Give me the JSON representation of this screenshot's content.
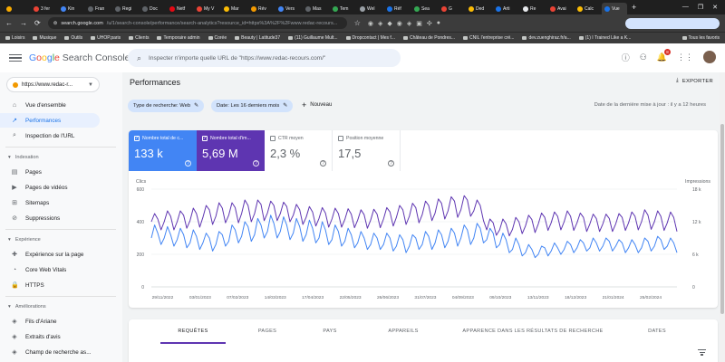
{
  "browser": {
    "tabs": [
      {
        "label": "",
        "color": "#f9ab00"
      },
      {
        "label": "3 fer",
        "color": "#ea4335"
      },
      {
        "label": "Kin",
        "color": "#4285f4"
      },
      {
        "label": "Fran",
        "color": "#5f6368"
      },
      {
        "label": "Regi",
        "color": "#5f6368"
      },
      {
        "label": "Doc",
        "color": "#5f6368"
      },
      {
        "label": "Netf",
        "color": "#e50914"
      },
      {
        "label": "My V",
        "color": "#ea4335"
      },
      {
        "label": "Mar",
        "color": "#fbbc05"
      },
      {
        "label": "Rév",
        "color": "#f29900"
      },
      {
        "label": "Vers",
        "color": "#4285f4"
      },
      {
        "label": "Mas",
        "color": "#5f6368"
      },
      {
        "label": "Tem",
        "color": "#34a853"
      },
      {
        "label": "Wel",
        "color": "#9aa0a6"
      },
      {
        "label": "Réf",
        "color": "#1a73e8"
      },
      {
        "label": "Sea",
        "color": "#34a853"
      },
      {
        "label": "G",
        "color": "#ea4335"
      },
      {
        "label": "Ded",
        "color": "#fbbc05"
      },
      {
        "label": "Arti",
        "color": "#1a73e8"
      },
      {
        "label": "Re",
        "color": "#e8eaed"
      },
      {
        "label": "Avai",
        "color": "#ea4335"
      },
      {
        "label": "Calc",
        "color": "#fbbc05"
      },
      {
        "label": "Vue",
        "color": "#1a73e8"
      }
    ],
    "active_tab": 22,
    "new_tab": "+",
    "window_controls": [
      "—",
      "❐",
      "✕"
    ],
    "url_host": "search.google.com",
    "url_path": "/u/1/search-console/performance/search-analytics?resource_id=https%3A%2F%2Fwww.redac-recours...",
    "bookmarks": [
      "Loisirs",
      "Musique",
      "Outils",
      "UHOP.paris",
      "Clients",
      "Temporaire admin",
      "Corée",
      "Beauty | Latitude37",
      "(11) Guillaume Mult...",
      "Dropcontact | Mes f...",
      "Château de Pondres...",
      "CNIL l'entreprise cré...",
      "dev.zuenghiraz.fr/a...",
      "(1) I Trained Like a K..."
    ],
    "bookmarks_end": "Tous les favoris"
  },
  "app": {
    "logo_google": [
      "G",
      "o",
      "o",
      "g",
      "l",
      "e"
    ],
    "logo_rest": " Search Console",
    "search_placeholder": "Inspecter n'importe quelle URL de \"https://www.redac-recours.com/\"",
    "notification_count": "8"
  },
  "sidebar": {
    "property": "https://www.redac-r...",
    "top_items": [
      {
        "label": "Vue d'ensemble",
        "icon": "home-icon",
        "glyph": "⌂",
        "active": false
      },
      {
        "label": "Performances",
        "icon": "trending-icon",
        "glyph": "↗",
        "active": true
      },
      {
        "label": "Inspection de l'URL",
        "icon": "search-icon",
        "glyph": "⌕",
        "active": false
      }
    ],
    "sections": [
      {
        "title": "Indexation",
        "items": [
          {
            "label": "Pages",
            "icon": "pages-icon",
            "glyph": "▤"
          },
          {
            "label": "Pages de vidéos",
            "icon": "video-icon",
            "glyph": "▶"
          },
          {
            "label": "Sitemaps",
            "icon": "sitemap-icon",
            "glyph": "⊞"
          },
          {
            "label": "Suppressions",
            "icon": "remove-icon",
            "glyph": "⊘"
          }
        ]
      },
      {
        "title": "Expérience",
        "items": [
          {
            "label": "Expérience sur la page",
            "icon": "experience-icon",
            "glyph": "✚"
          },
          {
            "label": "Core Web Vitals",
            "icon": "speed-icon",
            "glyph": "◔"
          },
          {
            "label": "HTTPS",
            "icon": "lock-icon",
            "glyph": "🔒"
          }
        ]
      },
      {
        "title": "Améliorations",
        "items": [
          {
            "label": "Fils d'Ariane",
            "icon": "breadcrumb-icon",
            "glyph": "◈"
          },
          {
            "label": "Extraits d'avis",
            "icon": "review-icon",
            "glyph": "◈"
          },
          {
            "label": "Champ de recherche as...",
            "icon": "sitelinks-icon",
            "glyph": "◈"
          }
        ]
      }
    ]
  },
  "main": {
    "title": "Performances",
    "export_label": "EXPORTER",
    "chip_search_type": "Type de recherche: Web",
    "chip_date": "Date: Les 16 derniers mois",
    "new_label": "Nouveau",
    "last_update": "Date de la dernière mise à jour : il y a 12 heures",
    "metrics": [
      {
        "label": "Nombre total de c...",
        "value": "133 k",
        "checked": true
      },
      {
        "label": "Nombre total d'im...",
        "value": "5,69 M",
        "checked": true
      },
      {
        "label": "CTR moyen",
        "value": "2,3 %",
        "checked": false
      },
      {
        "label": "Position moyenne",
        "value": "17,5",
        "checked": false
      }
    ],
    "data_tabs": [
      "REQUÊTES",
      "PAGES",
      "PAYS",
      "APPAREILS",
      "APPARENCE DANS LES RÉSULTATS DE RECHERCHE",
      "DATES"
    ],
    "active_data_tab": 0
  },
  "chart_data": {
    "type": "line",
    "ylabel_left": "Clics",
    "ylabel_right": "Impressions",
    "y_left_ticks": [
      "600",
      "400",
      "200",
      "0"
    ],
    "y_right_ticks": [
      "18 k",
      "12 k",
      "6 k",
      "0"
    ],
    "ylim_left": [
      0,
      600
    ],
    "ylim_right": [
      0,
      18000
    ],
    "x_ticks": [
      "29/11/2022",
      "03/01/2023",
      "07/02/2023",
      "14/03/2023",
      "17/04/2023",
      "22/05/2023",
      "26/06/2023",
      "31/07/2023",
      "04/09/2023",
      "09/10/2023",
      "13/11/2023",
      "18/12/2023",
      "21/01/2024",
      "25/02/2024"
    ],
    "x_range": [
      "2022-11-29",
      "2024-03-20"
    ],
    "series": [
      {
        "name": "Clics",
        "axis": "left",
        "color": "#4285f4",
        "values": [
          300,
          380,
          330,
          260,
          300,
          370,
          320,
          250,
          290,
          360,
          320,
          240,
          270,
          350,
          310,
          230,
          270,
          330,
          300,
          220,
          260,
          340,
          320,
          250,
          280,
          380,
          350,
          270,
          310,
          400,
          370,
          280,
          320,
          420,
          380,
          300,
          340,
          440,
          390,
          300,
          340,
          430,
          380,
          290,
          330,
          420,
          370,
          280,
          320,
          410,
          360,
          270,
          300,
          400,
          350,
          260,
          290,
          380,
          340,
          250,
          280,
          360,
          320,
          240,
          270,
          340,
          300,
          230,
          260,
          330,
          300,
          230,
          260,
          330,
          300,
          220,
          250,
          320,
          290,
          210,
          250,
          320,
          300,
          230,
          260,
          340,
          310,
          230,
          270,
          350,
          320,
          240,
          280,
          360,
          330,
          250,
          300,
          380,
          350,
          260,
          300,
          390,
          360,
          270,
          290,
          360,
          330,
          240,
          260,
          330,
          290,
          210,
          230,
          300,
          260,
          190,
          210,
          260,
          230,
          180,
          200,
          250,
          240,
          190,
          220,
          270,
          240,
          200,
          230,
          280,
          260,
          210,
          240,
          290,
          270,
          220,
          240,
          300,
          270,
          220,
          250,
          300,
          280,
          220,
          250,
          290,
          270,
          210,
          240,
          290,
          260,
          210,
          240,
          300,
          280,
          220,
          250,
          310,
          290,
          230,
          250,
          300,
          270,
          210
        ]
      },
      {
        "name": "Impressions",
        "axis": "right",
        "color": "#5e35b1",
        "values": [
          12000,
          13500,
          12500,
          10500,
          12000,
          14000,
          13000,
          10500,
          12000,
          14000,
          13200,
          10800,
          12200,
          14500,
          13500,
          11000,
          12800,
          15000,
          14200,
          11500,
          13000,
          15500,
          14500,
          11800,
          13200,
          15500,
          14600,
          11800,
          13500,
          16000,
          15000,
          12000,
          13500,
          16000,
          15200,
          12200,
          13600,
          15800,
          15000,
          12200,
          13500,
          15600,
          14800,
          12000,
          13200,
          15200,
          14200,
          11500,
          12800,
          14800,
          13800,
          11200,
          12600,
          14600,
          13600,
          11000,
          12500,
          14500,
          13500,
          11000,
          12400,
          14400,
          13400,
          10900,
          12300,
          14200,
          13300,
          10800,
          12300,
          14300,
          13400,
          10900,
          12500,
          14600,
          13800,
          11200,
          12800,
          15000,
          14200,
          11500,
          13000,
          15400,
          14600,
          11800,
          13300,
          15800,
          15000,
          12200,
          13600,
          16200,
          15400,
          12500,
          14000,
          16600,
          15800,
          12800,
          14200,
          16800,
          16000,
          13000,
          14000,
          16000,
          15000,
          12200,
          10500,
          12500,
          11800,
          9500,
          10500,
          12500,
          11600,
          9400,
          10600,
          12800,
          12000,
          9800,
          11200,
          13200,
          12400,
          10000,
          11600,
          13600,
          12800,
          10400,
          11800,
          13800,
          13000,
          10500,
          12000,
          14000,
          13000,
          10400,
          11800,
          13600,
          12800,
          10200,
          11600,
          13400,
          12600,
          10200,
          11600,
          13400,
          12600,
          10200,
          11600,
          13500,
          12800,
          10400,
          11800,
          13800,
          13000,
          10500,
          12000,
          14200,
          13200,
          10600,
          12000,
          14000,
          13000,
          10400,
          11800,
          13800,
          12800,
          10200
        ]
      }
    ]
  }
}
